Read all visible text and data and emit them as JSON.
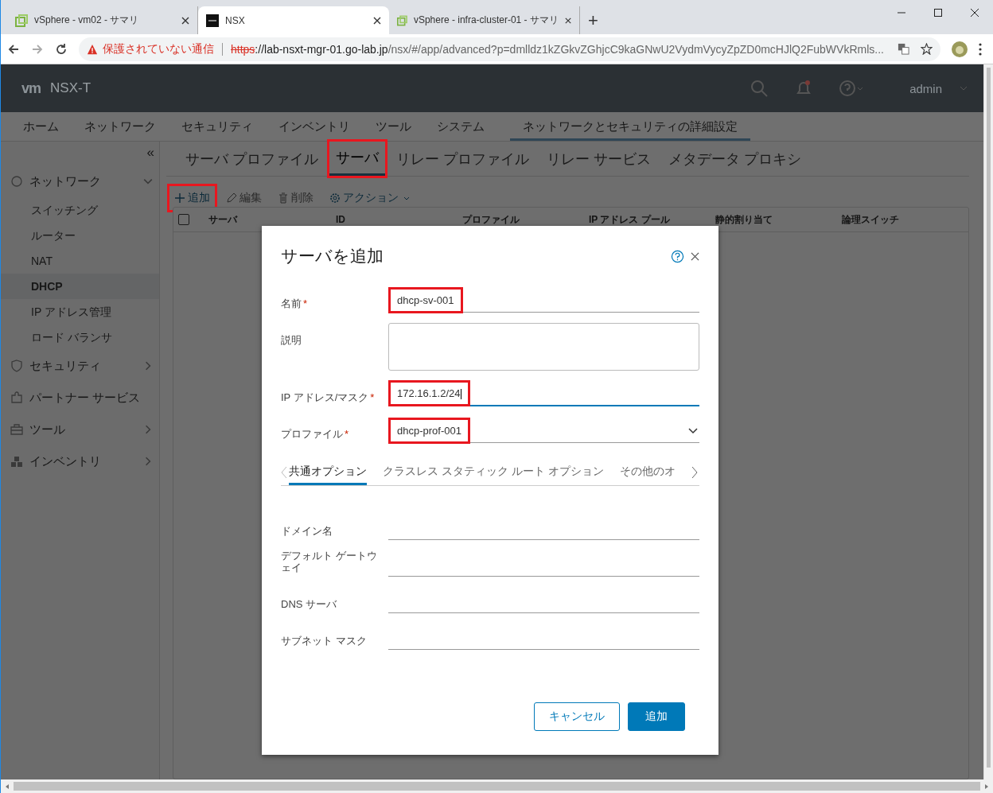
{
  "browser": {
    "tabs": [
      {
        "title": "vSphere - vm02 - サマリ",
        "selected": false,
        "kind": "vsphere"
      },
      {
        "title": "NSX",
        "selected": true,
        "kind": "nsx"
      },
      {
        "title": "vSphere - infra-cluster-01 - サマリ",
        "selected": false,
        "kind": "vsphere"
      }
    ],
    "new_tab": "+",
    "security_warning": "保護されていない通信",
    "url_scheme": "https",
    "url_host": "://lab-nsxt-mgr-01.go-lab.jp",
    "url_path": "/nsx/#/app/advanced?p=dmlldz1kZGkvZGhjcC9kaGNwU2VydmVycyZpZD0mcHJlQ2FubWVkRmls..."
  },
  "app": {
    "logo": "vm",
    "product": "NSX-T",
    "user": "admin"
  },
  "nav": [
    {
      "label": "ホーム",
      "selected": false
    },
    {
      "label": "ネットワーク",
      "selected": false
    },
    {
      "label": "セキュリティ",
      "selected": false
    },
    {
      "label": "インベントリ",
      "selected": false
    },
    {
      "label": "ツール",
      "selected": false
    },
    {
      "label": "システム",
      "selected": false
    },
    {
      "label": "ネットワークとセキュリティの詳細設定",
      "selected": true
    }
  ],
  "sidebar": {
    "collapse": "«",
    "groups": [
      {
        "label": "ネットワーク",
        "expanded": true,
        "has_children": true,
        "children": [
          {
            "label": "スイッチング",
            "selected": false
          },
          {
            "label": "ルーター",
            "selected": false
          },
          {
            "label": "NAT",
            "selected": false
          },
          {
            "label": "DHCP",
            "selected": true
          },
          {
            "label": "IP アドレス管理",
            "selected": false
          },
          {
            "label": "ロード バランサ",
            "selected": false
          }
        ]
      },
      {
        "label": "セキュリティ",
        "expanded": false,
        "has_children": true
      },
      {
        "label": "パートナー サービス",
        "has_children": false
      },
      {
        "label": "ツール",
        "expanded": false,
        "has_children": true
      },
      {
        "label": "インベントリ",
        "expanded": false,
        "has_children": true
      }
    ]
  },
  "subtabs": [
    {
      "label": "サーバ プロファイル",
      "selected": false,
      "highlighted": false
    },
    {
      "label": "サーバ",
      "selected": true,
      "highlighted": true
    },
    {
      "label": "リレー プロファイル",
      "selected": false,
      "highlighted": false
    },
    {
      "label": "リレー サービス",
      "selected": false,
      "highlighted": false
    },
    {
      "label": "メタデータ プロキシ",
      "selected": false,
      "highlighted": false
    }
  ],
  "toolbar": [
    {
      "label": "追加",
      "kind": "add",
      "disabled": false,
      "highlighted": true
    },
    {
      "label": "編集",
      "kind": "edit",
      "disabled": true,
      "highlighted": false
    },
    {
      "label": "削除",
      "kind": "delete",
      "disabled": true,
      "highlighted": false
    },
    {
      "label": "アクション",
      "kind": "actions",
      "disabled": false,
      "highlighted": false
    }
  ],
  "table": {
    "select_all_checked": false,
    "columns": [
      "サーバ",
      "ID",
      "プロファイル",
      "IP アドレス プール",
      "静的割り当て",
      "論理スイッチ"
    ]
  },
  "dialog": {
    "title": "サーバを追加",
    "fields": [
      {
        "label": "名前",
        "required_mark": "*",
        "kind": "text",
        "value": "dhcp-sv-001",
        "highlighted": true
      },
      {
        "label": "説明",
        "kind": "textarea"
      },
      {
        "label": "IP アドレス/マスク",
        "required_mark": "*",
        "kind": "text",
        "value": "172.16.1.2/24",
        "focused": true,
        "highlighted": true
      },
      {
        "label": "プロファイル",
        "required_mark": "*",
        "kind": "select",
        "value": "dhcp-prof-001",
        "highlighted": true
      }
    ],
    "tabs": [
      {
        "label": "共通オプション",
        "selected": true
      },
      {
        "label": "クラスレス スタティック ルート オプション",
        "selected": false
      },
      {
        "label": "その他のオ",
        "selected": false
      }
    ],
    "options": [
      {
        "label": "ドメイン名"
      },
      {
        "label": "デフォルト ゲートウェイ"
      },
      {
        "label": "DNS サーバ"
      },
      {
        "label": "サブネット マスク"
      }
    ],
    "buttons": [
      {
        "label": "キャンセル",
        "kind": "secondary"
      },
      {
        "label": "追加",
        "kind": "primary"
      }
    ]
  }
}
